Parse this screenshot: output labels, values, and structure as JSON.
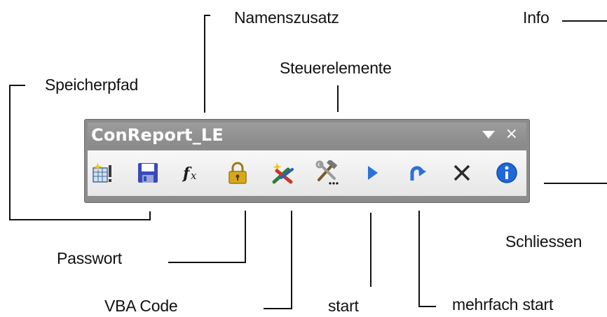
{
  "toolbar": {
    "title": "ConReport_LE",
    "menu_icon": "dropdown-triangle-icon",
    "close_icon": "close-x-icon",
    "buttons": [
      {
        "name": "speicherpfad-button",
        "icon": "folder-settings-icon"
      },
      {
        "name": "save-button",
        "icon": "floppy-disk-icon"
      },
      {
        "name": "function-button",
        "icon": "fx-icon"
      },
      {
        "name": "password-button",
        "icon": "padlock-icon"
      },
      {
        "name": "vba-code-button",
        "icon": "tools-sparkle-icon"
      },
      {
        "name": "steuerelemente-button",
        "icon": "hammer-wrench-icon"
      },
      {
        "name": "start-button",
        "icon": "play-triangle-icon"
      },
      {
        "name": "mehrfach-start-button",
        "icon": "redo-arrow-icon"
      },
      {
        "name": "schliessen-button",
        "icon": "black-x-icon"
      },
      {
        "name": "info-button",
        "icon": "info-circle-icon"
      }
    ]
  },
  "callouts": {
    "namenszusatz": "Namenszusatz",
    "info": "Info",
    "speicherpfad": "Speicherpfad",
    "steuerelemente": "Steuerelemente",
    "schliessen": "Schliessen",
    "passwort": "Passwort",
    "vba_code": "VBA Code",
    "start": "start",
    "mehrfach_start": "mehrfach start"
  },
  "colors": {
    "toolbar_frame": "#8c8c8c",
    "title_text": "#ffffff",
    "icon_bar": "#f0f0f0",
    "save_blue": "#3a49b8",
    "play_blue": "#2a72d6",
    "info_blue": "#1f68d8",
    "lock_gold": "#d8a81c"
  }
}
